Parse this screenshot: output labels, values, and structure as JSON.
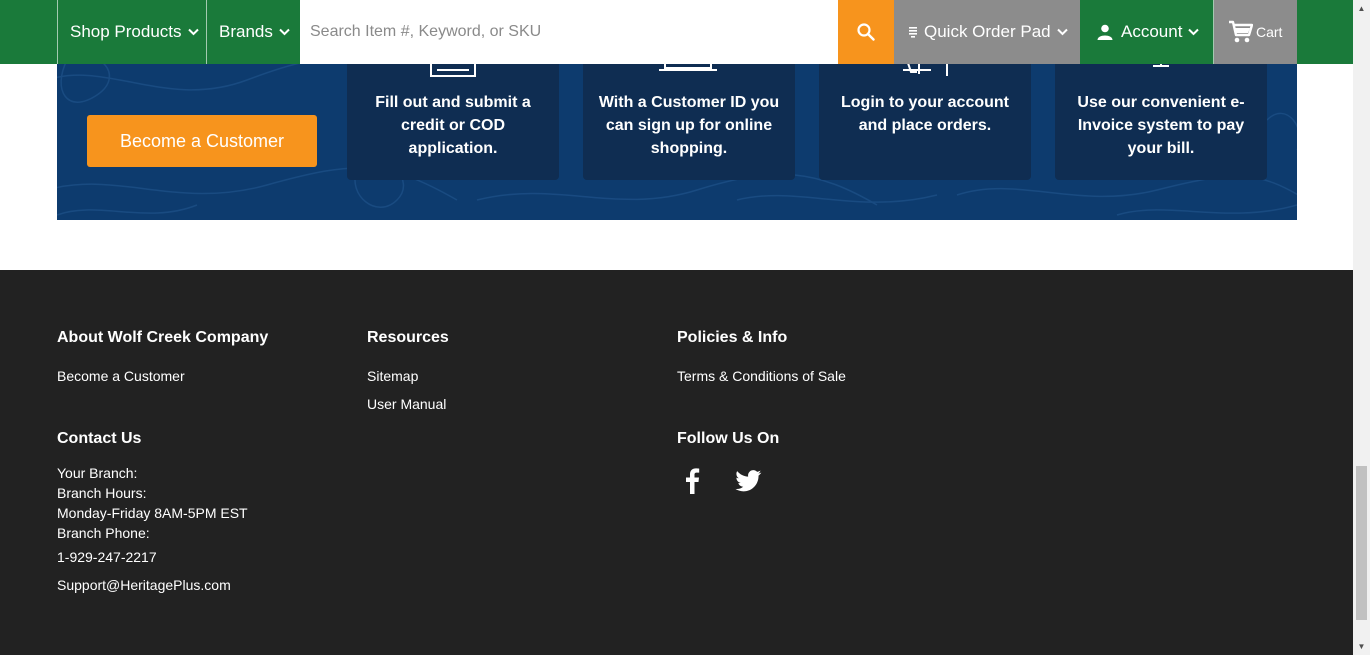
{
  "nav": {
    "shop_products": "Shop Products",
    "brands": "Brands",
    "search_placeholder": "Search Item #, Keyword, or SKU",
    "quick_order_pad": "Quick Order Pad",
    "account": "Account",
    "cart": "Cart",
    "colors": {
      "green": "#1a7a3a",
      "orange": "#f7941d",
      "gray": "#8c8c8c"
    }
  },
  "banner": {
    "become_customer_button": "Become a Customer",
    "cards": [
      {
        "text": "Fill out and submit a credit or COD application.",
        "icon": "form-icon"
      },
      {
        "text": "With a Customer ID you can sign up for online shopping.",
        "icon": "laptop-icon"
      },
      {
        "text": "Login to your account and place orders.",
        "icon": "cart-icon"
      },
      {
        "text": "Use our convenient e-Invoice system to pay your bill.",
        "icon": "invoice-icon"
      }
    ],
    "colors": {
      "background": "#0d3b6e",
      "card": "#0f2d52"
    }
  },
  "footer": {
    "about": {
      "heading": "About Wolf Creek Company",
      "links": [
        "Become a Customer"
      ]
    },
    "resources": {
      "heading": "Resources",
      "links": [
        "Sitemap",
        "User Manual"
      ]
    },
    "policies": {
      "heading": "Policies & Info",
      "links": [
        "Terms & Conditions of Sale"
      ]
    },
    "contact": {
      "heading": "Contact Us",
      "your_branch": "Your Branch:",
      "branch_hours_label": "Branch Hours:",
      "branch_hours": "Monday-Friday 8AM-5PM EST",
      "branch_phone_label": "Branch Phone:",
      "phone": "1-929-247-2217",
      "email": "Support@HeritagePlus.com"
    },
    "follow": {
      "heading": "Follow Us On",
      "icons": [
        "facebook-icon",
        "twitter-icon"
      ]
    },
    "colors": {
      "background": "#222222"
    }
  }
}
